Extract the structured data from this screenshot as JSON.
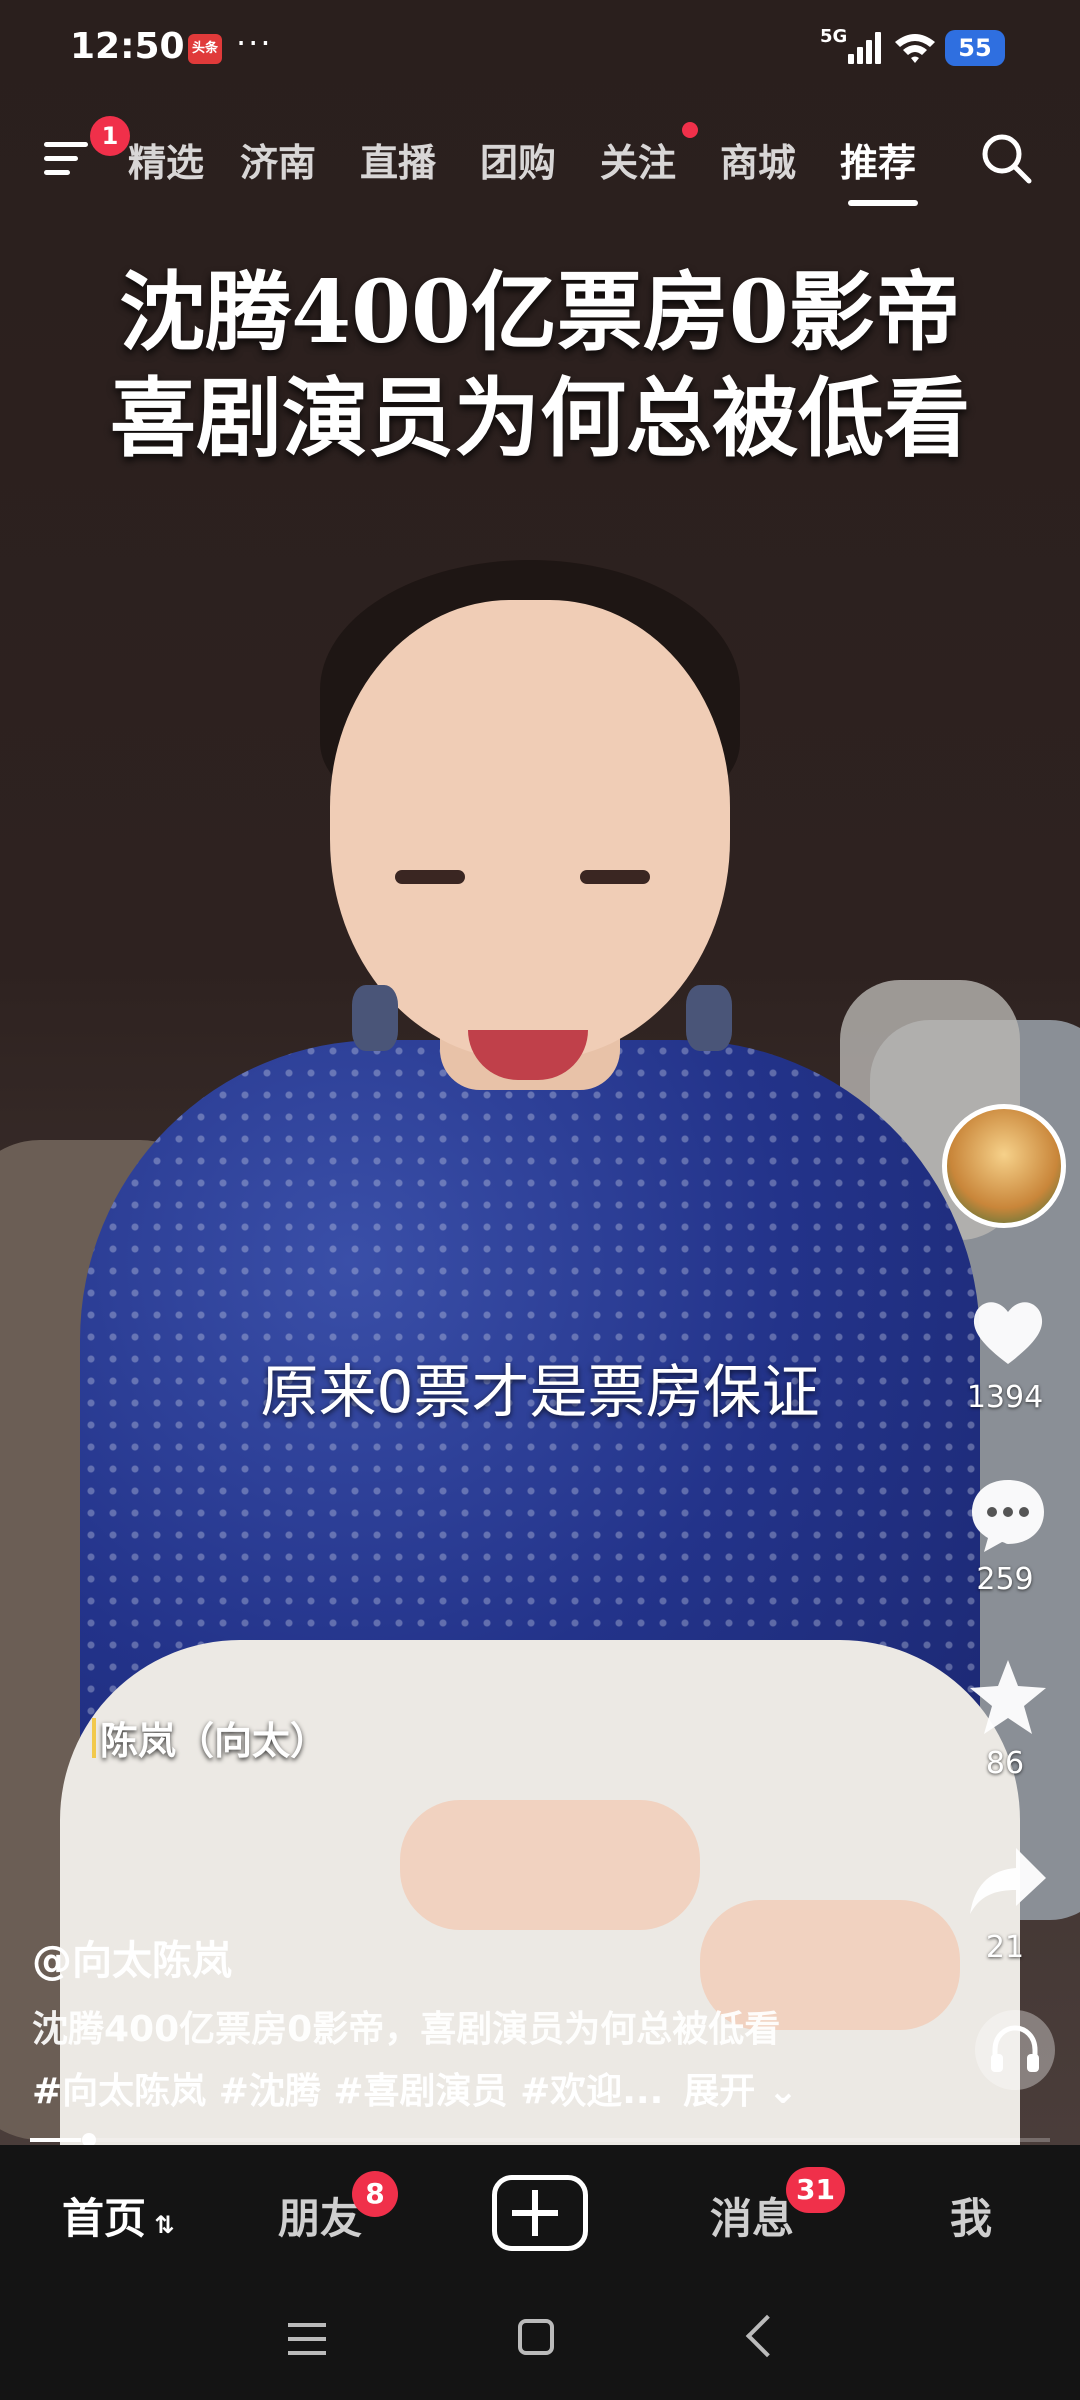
{
  "status_bar": {
    "time": "12:50",
    "app_badge": "头条",
    "more": "···",
    "network": "5G",
    "battery": "55"
  },
  "top_nav": {
    "menu_badge": "1",
    "tabs": [
      "精选",
      "济南",
      "直播",
      "团购",
      "关注",
      "商城",
      "推荐"
    ],
    "active_tab": "推荐"
  },
  "video": {
    "headline_line1": "沈腾400亿票房0影帝",
    "headline_line2": "喜剧演员为何总被低看",
    "subtitle": "原来0票才是票房保证",
    "speaker_label": "陈岚（向太）"
  },
  "actions": {
    "likes": "1394",
    "comments": "259",
    "favorites": "86",
    "shares": "21"
  },
  "caption": {
    "author": "@向太陈岚",
    "description": "沈腾400亿票房0影帝，喜剧演员为何总被低看",
    "tags": "#向太陈岚 #沈腾 #喜剧演员 #欢迎...",
    "expand": "展开"
  },
  "progress_fraction": 0.05,
  "bottom_nav": {
    "home": "首页",
    "friends": "朋友",
    "friends_badge": "8",
    "messages": "消息",
    "messages_badge": "31",
    "me": "我"
  },
  "colors": {
    "badge_red": "#f0304a",
    "battery_blue": "#2f6fe0"
  }
}
